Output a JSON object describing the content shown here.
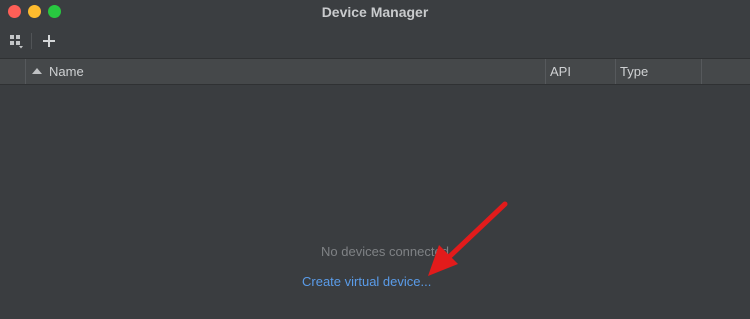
{
  "window": {
    "title": "Device Manager"
  },
  "toolbar": {
    "view_icon": "device-grid-icon",
    "add_icon": "plus-icon",
    "add_label": "+"
  },
  "table": {
    "columns": [
      "Name",
      "API",
      "Type"
    ],
    "sort_icon": "sort-ascending-icon"
  },
  "empty_state": {
    "message": "No devices connected",
    "link": "Create virtual device..."
  },
  "colors": {
    "background": "#3a3d40",
    "link": "#5a9ce9",
    "annotation_arrow": "#e21b1b"
  }
}
